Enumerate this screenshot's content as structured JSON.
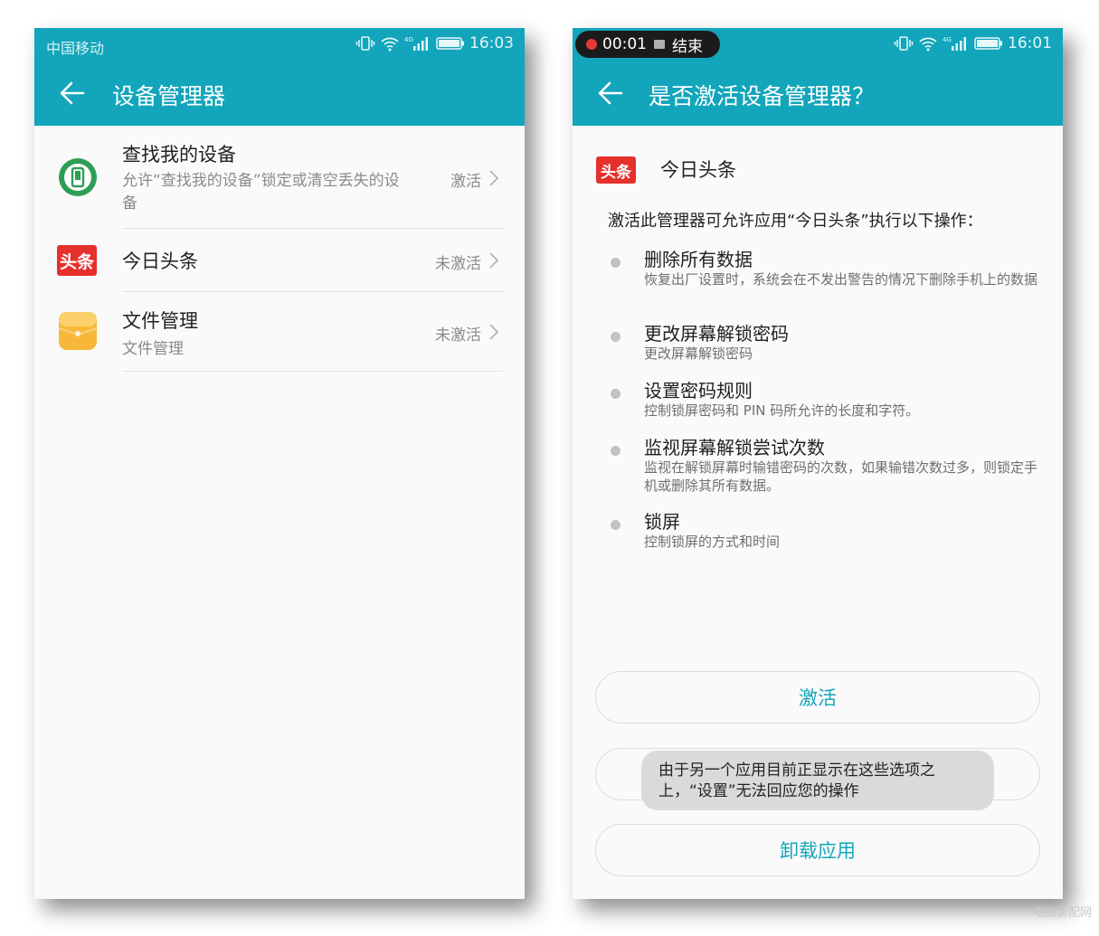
{
  "left_screen": {
    "status_bar": {
      "carrier": "中国移动",
      "network": "4G",
      "time": "16:03"
    },
    "title": "设备管理器",
    "items": [
      {
        "name": "查找我的设备",
        "description": "允许“查找我的设备”锁定或清空丢失的设备",
        "state": "激活",
        "icon": "find-device-icon"
      },
      {
        "name": "今日头条",
        "description": "",
        "state": "未激活",
        "icon": "toutiao-logo",
        "icon_text": "头条"
      },
      {
        "name": "文件管理",
        "description": "文件管理",
        "state": "未激活",
        "icon": "file-manager-icon"
      }
    ]
  },
  "right_screen": {
    "status_bar": {
      "recording_time": "00:01",
      "end_label": "结束",
      "network": "4G",
      "time": "16:01"
    },
    "title": "是否激活设备管理器？",
    "app_name": "今日头条",
    "app_icon_text": "头条",
    "intro": "激活此管理器可允许应用“今日头条”执行以下操作：",
    "permissions": [
      {
        "title": "删除所有数据",
        "description": "恢复出厂设置时，系统会在不发出警告的情况下删除手机上的数据"
      },
      {
        "title": "更改屏幕解锁密码",
        "description": "更改屏幕解锁密码"
      },
      {
        "title": "设置密码规则",
        "description": "控制锁屏密码和 PIN 码所允许的长度和字符。"
      },
      {
        "title": "监视屏幕解锁尝试次数",
        "description": "监视在解锁屏幕时输错密码的次数，如果输错次数过多，则锁定手机或删除其所有数据。"
      },
      {
        "title": "锁屏",
        "description": "控制锁屏的方式和时间"
      }
    ],
    "buttons": {
      "activate": "激活",
      "uninstall": "卸载应用"
    },
    "toast": "由于另一个应用目前正显示在这些选项之上，“设置”无法回应您的操作"
  },
  "watermark": "电脑装配网",
  "colors": {
    "accent": "#12a5bb",
    "background": "#fafafa",
    "toutiao_red": "#e5302c",
    "find_device_green": "#2e9e54",
    "file_manager_yellow": "#f7b83a"
  }
}
